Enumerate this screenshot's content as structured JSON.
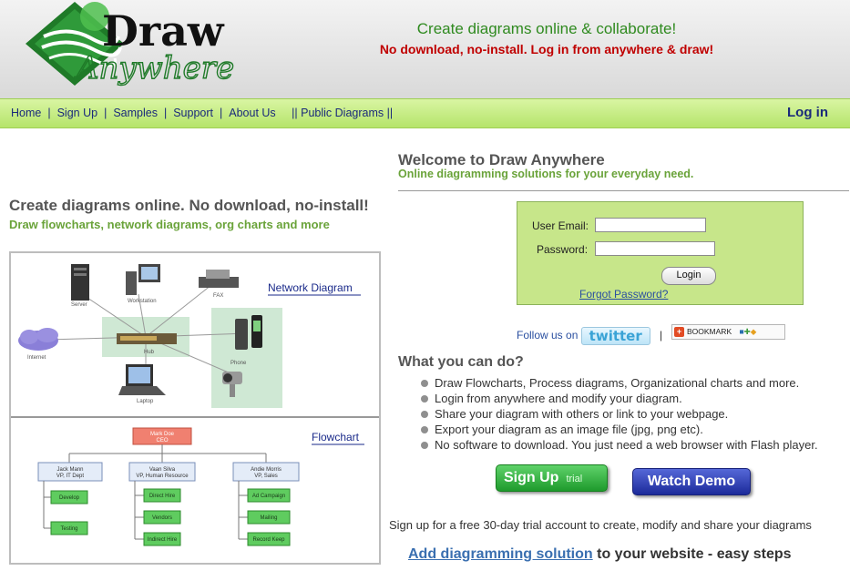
{
  "header": {
    "logo_line1": "Draw",
    "logo_line2": "Anywhere",
    "tagline1": "Create diagrams online & collaborate!",
    "tagline2": "No download, no-install. Log in from anywhere & draw!"
  },
  "nav": {
    "items": [
      "Home",
      "Sign Up",
      "Samples",
      "Support",
      "About Us",
      "|| Public Diagrams ||"
    ],
    "login": "Log in"
  },
  "left": {
    "title": "Create diagrams online. No download, no-install!",
    "subtitle": "Draw flowcharts, network diagrams, org charts and more",
    "network_label": "Network Diagram",
    "flowchart_label": "Flowchart",
    "network_nodes": [
      "Server",
      "Workstation",
      "FAX",
      "Internet",
      "Hub",
      "Phone",
      "Laptop"
    ],
    "flow_top": "Mark Doe\nCEO",
    "flow_mid": [
      {
        "line1": "Jack Mann",
        "line2": "VP, IT Dept"
      },
      {
        "line1": "Vaan Silva",
        "line2": "VP, Human Resource"
      },
      {
        "line1": "Andie Morris",
        "line2": "VP, Sales"
      }
    ],
    "flow_leaves": [
      [
        "Develop",
        "Testing"
      ],
      [
        "Direct Hire",
        "Vendors",
        "Indirect Hire"
      ],
      [
        "Ad Campaign",
        "Mailing",
        "Record Keep"
      ]
    ]
  },
  "welcome": {
    "title": "Welcome to Draw Anywhere",
    "subtitle": "Online diagramming solutions for your everyday need."
  },
  "login_form": {
    "email_label": "User Email:",
    "email_value": "",
    "password_label": "Password:",
    "password_value": "",
    "button": "Login",
    "forgot": "Forgot Password?"
  },
  "social": {
    "follow": "Follow us on",
    "twitter": "twitter",
    "pipe": "|",
    "bookmark": "BOOKMARK"
  },
  "features": {
    "title": "What you can do?",
    "items": [
      "Draw Flowcharts, Process diagrams, Organizational charts and more.",
      "Login from anywhere and modify your diagram.",
      "Share your diagram with others or link to your webpage.",
      "Export your diagram as an image file (jpg, png etc).",
      "No software to download. You just need a web browser with Flash player."
    ]
  },
  "cta": {
    "signup": "Sign Up",
    "signup_badge": "trial",
    "demo": "Watch Demo",
    "trial_text": "Sign up for a free 30-day trial account to create, modify and share your diagrams",
    "add_link": "Add diagramming solution",
    "add_rest": " to your website - easy steps"
  },
  "colors": {
    "nav_green": "#b5e46a",
    "accent_green": "#6aa33a",
    "tag_red": "#c00000",
    "link_blue": "#1a2a7a"
  }
}
